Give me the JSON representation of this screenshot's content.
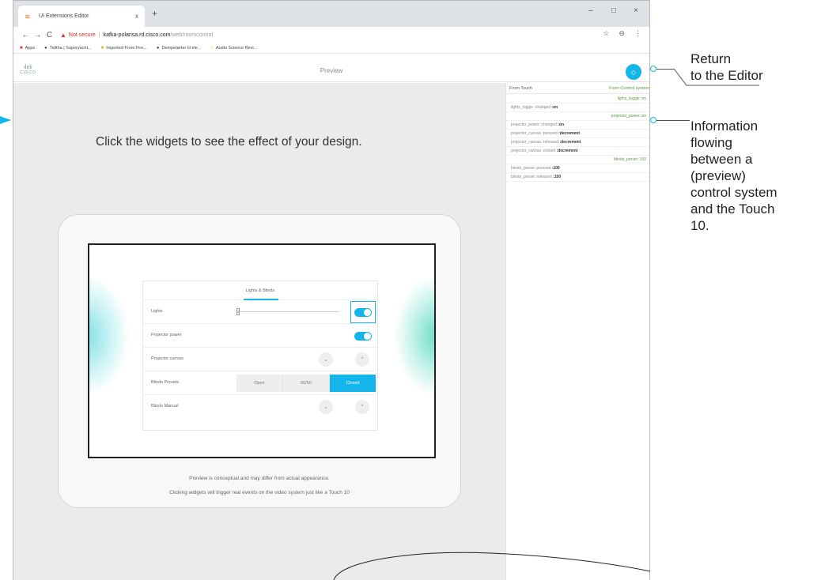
{
  "browser": {
    "tab_title": "UI Extensions Editor",
    "tab_close": "x",
    "new_tab": "+",
    "window_controls": {
      "minimize": "–",
      "maximize": "□",
      "close": "×"
    },
    "nav": {
      "back": "←",
      "forward": "→",
      "reload": "C"
    },
    "security_label": "Not secure",
    "url_host": "kafka-polarisa.rd.cisco.com",
    "url_path": "/web/roomcontrol",
    "star": "☆",
    "menu": "⋮",
    "bookmarks": [
      "Apps",
      "Talitha | Superyacht...",
      "Imported From Fire...",
      "Dempetørter til ele...",
      "Audio Science Revi..."
    ]
  },
  "app": {
    "logo_bars": "ılıılı",
    "logo_text": "CISCO",
    "title": "Preview",
    "editor_button_icon": "◇"
  },
  "preview": {
    "intro": "Click the widgets to see the effect of your design.",
    "panel_tab": "Lights & Blinds",
    "rows": {
      "lights": "Lights",
      "projector_power": "Projector power",
      "projector_canvas": "Projector canvas",
      "blinds_presets": "Blinds Presets",
      "blinds_manual": "Blinds Manual"
    },
    "slider_value": "2",
    "presets": [
      "Open",
      "50/50",
      "Closed"
    ],
    "selected_preset": "Closed",
    "down_glyph": "⌄",
    "up_glyph": "⌃",
    "note_line1": "Preview is conceptual and may differ from actual appearance.",
    "note_line2": "Clicking widgets will trigger real events on the video system just like a Touch 10"
  },
  "log": {
    "from_touch": "From Touch",
    "from_control": "From Control system",
    "entries": [
      {
        "side": "control",
        "text": "lights_toggle :on"
      },
      {
        "side": "touch",
        "widget": "lights_toggle :changed",
        "value": ":on"
      },
      {
        "side": "control",
        "text": "projector_power :on"
      },
      {
        "side": "touch",
        "widget": "projector_power :changed",
        "value": ":on"
      },
      {
        "side": "touch",
        "widget": "projector_canvas :pressed",
        "value": ":decrement"
      },
      {
        "side": "touch",
        "widget": "projector_canvas :released",
        "value": ":decrement"
      },
      {
        "side": "touch",
        "widget": "projector_canvas :clicked",
        "value": ":decrement"
      },
      {
        "side": "control",
        "text": "blinds_preset :100"
      },
      {
        "side": "touch",
        "widget": "blinds_preset :pressed",
        "value": ":100"
      },
      {
        "side": "touch",
        "widget": "blinds_preset :released",
        "value": ":100"
      }
    ]
  },
  "callouts": {
    "return_editor": [
      "Return",
      "to the Editor"
    ],
    "information": [
      "Information",
      "flowing",
      "between a",
      "(preview)",
      "control system",
      "and the Touch",
      "10."
    ]
  },
  "colors": {
    "accent": "#13b5ea",
    "control_text": "#5a9b3a",
    "warning": "#d93025"
  }
}
